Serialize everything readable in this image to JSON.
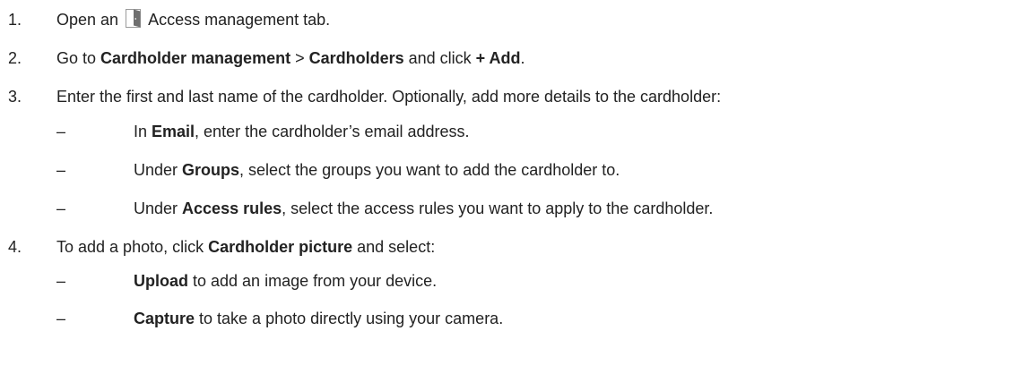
{
  "steps": [
    {
      "number": "1.",
      "before": "Open an",
      "icon": "door-icon",
      "after": "Access management tab."
    },
    {
      "number": "2.",
      "t1": "Go to ",
      "b1": "Cardholder management",
      "t2": " > ",
      "b2": "Cardholders",
      "t3": " and click ",
      "b3": "+ Add",
      "t4": "."
    },
    {
      "number": "3.",
      "text": "Enter the first and last name of the cardholder. Optionally, add more details to the cardholder:",
      "subitems": [
        {
          "dash": "–",
          "t1": "In ",
          "b1": "Email",
          "t2": ", enter the cardholder’s email address."
        },
        {
          "dash": "–",
          "t1": "Under ",
          "b1": "Groups",
          "t2": ", select the groups you want to add the cardholder to."
        },
        {
          "dash": "–",
          "t1": "Under ",
          "b1": "Access rules",
          "t2": ", select the access rules you want to apply to the cardholder."
        }
      ]
    },
    {
      "number": "4.",
      "t1": "To add a photo, click ",
      "b1": "Cardholder picture",
      "t2": " and select:",
      "subitems": [
        {
          "dash": "–",
          "b1": "Upload",
          "t2": " to add an image from your device."
        },
        {
          "dash": "–",
          "b1": "Capture",
          "t2": " to take a photo directly using your camera."
        }
      ]
    }
  ]
}
